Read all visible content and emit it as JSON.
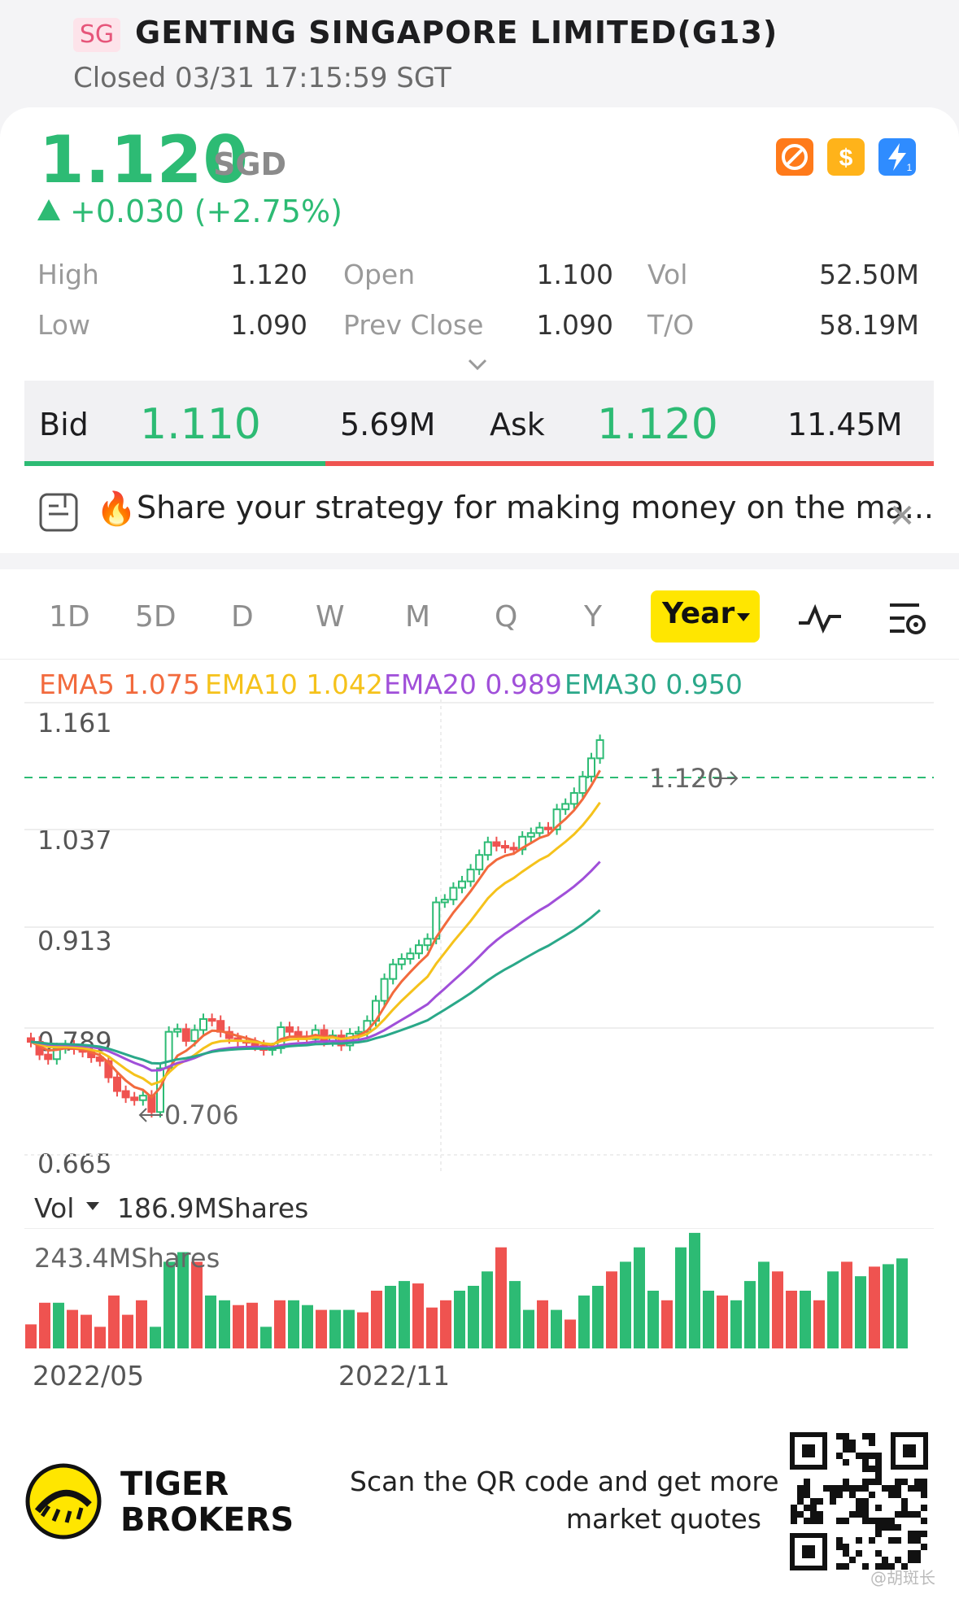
{
  "header": {
    "market_badge": "SG",
    "stock_name": "GENTING SINGAPORE LIMITED(G13)",
    "status": "Closed 03/31 17:15:59 SGT"
  },
  "quote": {
    "price": "1.120",
    "currency": "SGD",
    "change": "+0.030 (+2.75%)",
    "badges": [
      "no-margin-icon",
      "dollar-icon",
      "flash-icon"
    ],
    "colors": {
      "up": "#2dbb74",
      "down": "#ef5350"
    }
  },
  "stats": [
    {
      "label": "High",
      "value": "1.120"
    },
    {
      "label": "Open",
      "value": "1.100"
    },
    {
      "label": "Vol",
      "value": "52.50M"
    },
    {
      "label": "Low",
      "value": "1.090"
    },
    {
      "label": "Prev Close",
      "value": "1.090"
    },
    {
      "label": "T/O",
      "value": "58.19M"
    }
  ],
  "bidask": {
    "bid_label": "Bid",
    "bid_price": "1.110",
    "bid_size": "5.69M",
    "ask_label": "Ask",
    "ask_price": "1.120",
    "ask_size": "11.45M"
  },
  "banner": {
    "text": "Share your strategy for making money on the ma..."
  },
  "tabs": [
    "1D",
    "5D",
    "D",
    "W",
    "M",
    "Q",
    "Y"
  ],
  "active_tab": "Year",
  "ema": [
    {
      "label": "EMA5 1.075",
      "color": "#f26a3d"
    },
    {
      "label": "EMA10 1.042",
      "color": "#f5c21b"
    },
    {
      "label": "EMA20 0.989",
      "color": "#a04fd9"
    },
    {
      "label": "EMA30 0.950",
      "color": "#2aa889"
    }
  ],
  "chart_data": {
    "type": "candlestick",
    "y_axis_labels": [
      "1.161",
      "1.037",
      "0.913",
      "0.789",
      "0.665"
    ],
    "ylim": [
      0.665,
      1.161
    ],
    "last_price_label": "1.120",
    "low_label": "0.706",
    "x_labels": [
      "2022/05",
      "2022/11"
    ],
    "closes": [
      0.789,
      0.775,
      0.77,
      0.782,
      0.785,
      0.781,
      0.778,
      0.772,
      0.768,
      0.75,
      0.735,
      0.728,
      0.725,
      0.73,
      0.712,
      0.76,
      0.8,
      0.803,
      0.79,
      0.802,
      0.814,
      0.812,
      0.8,
      0.793,
      0.79,
      0.788,
      0.785,
      0.78,
      0.782,
      0.805,
      0.8,
      0.795,
      0.792,
      0.802,
      0.79,
      0.796,
      0.785,
      0.798,
      0.8,
      0.812,
      0.834,
      0.858,
      0.874,
      0.88,
      0.886,
      0.895,
      0.902,
      0.942,
      0.945,
      0.958,
      0.965,
      0.978,
      0.994,
      1.008,
      1.004,
      1.002,
      1.0,
      1.014,
      1.018,
      1.024,
      1.022,
      1.044,
      1.05,
      1.062,
      1.08,
      1.1,
      1.12
    ],
    "volume_label": "Vol",
    "volume_value": "186.9MShares",
    "volume_max_label": "243.4MShares",
    "volumes": [
      50,
      95,
      95,
      80,
      70,
      45,
      110,
      70,
      100,
      45,
      180,
      200,
      180,
      110,
      100,
      90,
      95,
      45,
      100,
      100,
      90,
      80,
      80,
      80,
      75,
      120,
      130,
      140,
      135,
      85,
      100,
      120,
      130,
      160,
      210,
      140,
      80,
      100,
      80,
      60,
      110,
      130,
      160,
      180,
      210,
      120,
      100,
      210,
      240,
      120,
      110,
      100,
      140,
      180,
      160,
      120,
      120,
      100,
      160,
      180,
      150,
      170,
      175,
      187
    ],
    "volume_colors": [
      "r",
      "r",
      "g",
      "r",
      "r",
      "r",
      "r",
      "r",
      "r",
      "g",
      "g",
      "g",
      "r",
      "g",
      "g",
      "r",
      "r",
      "g",
      "r",
      "g",
      "g",
      "r",
      "g",
      "g",
      "r",
      "r",
      "g",
      "g",
      "r",
      "r",
      "r",
      "g",
      "g",
      "g",
      "r",
      "g",
      "g",
      "r",
      "g",
      "r",
      "g",
      "g",
      "r",
      "g",
      "g",
      "g",
      "r",
      "g",
      "g",
      "g",
      "r",
      "g",
      "g",
      "g",
      "r",
      "r",
      "g",
      "r",
      "g",
      "r",
      "g",
      "r",
      "g",
      "g"
    ]
  },
  "footer": {
    "brand_line1": "TIGER",
    "brand_line2": "BROKERS",
    "scan_line1": "Scan the QR code and get more",
    "scan_line2": "market quotes",
    "watermark": "@胡斑长"
  }
}
